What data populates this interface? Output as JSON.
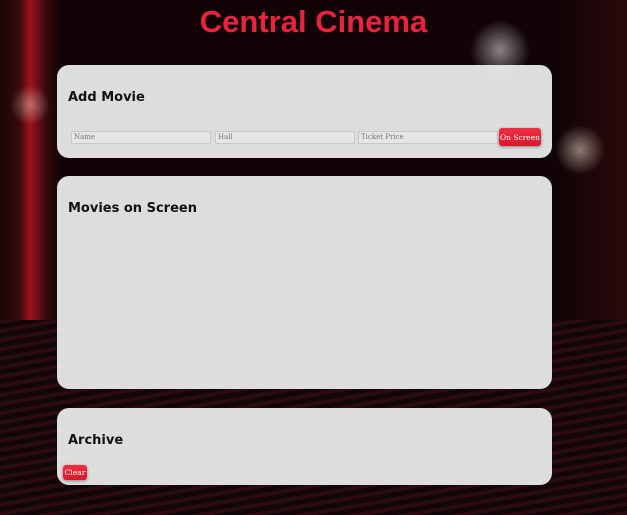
{
  "header": {
    "title": "Central Cinema"
  },
  "add_movie": {
    "heading": "Add Movie",
    "name_placeholder": "Name",
    "hall_placeholder": "Hall",
    "price_placeholder": "Ticket Price",
    "submit_label": "On Screen"
  },
  "movies": {
    "heading": "Movies on Screen"
  },
  "archive": {
    "heading": "Archive",
    "clear_label": "Clear"
  },
  "colors": {
    "accent": "#e8243c"
  }
}
